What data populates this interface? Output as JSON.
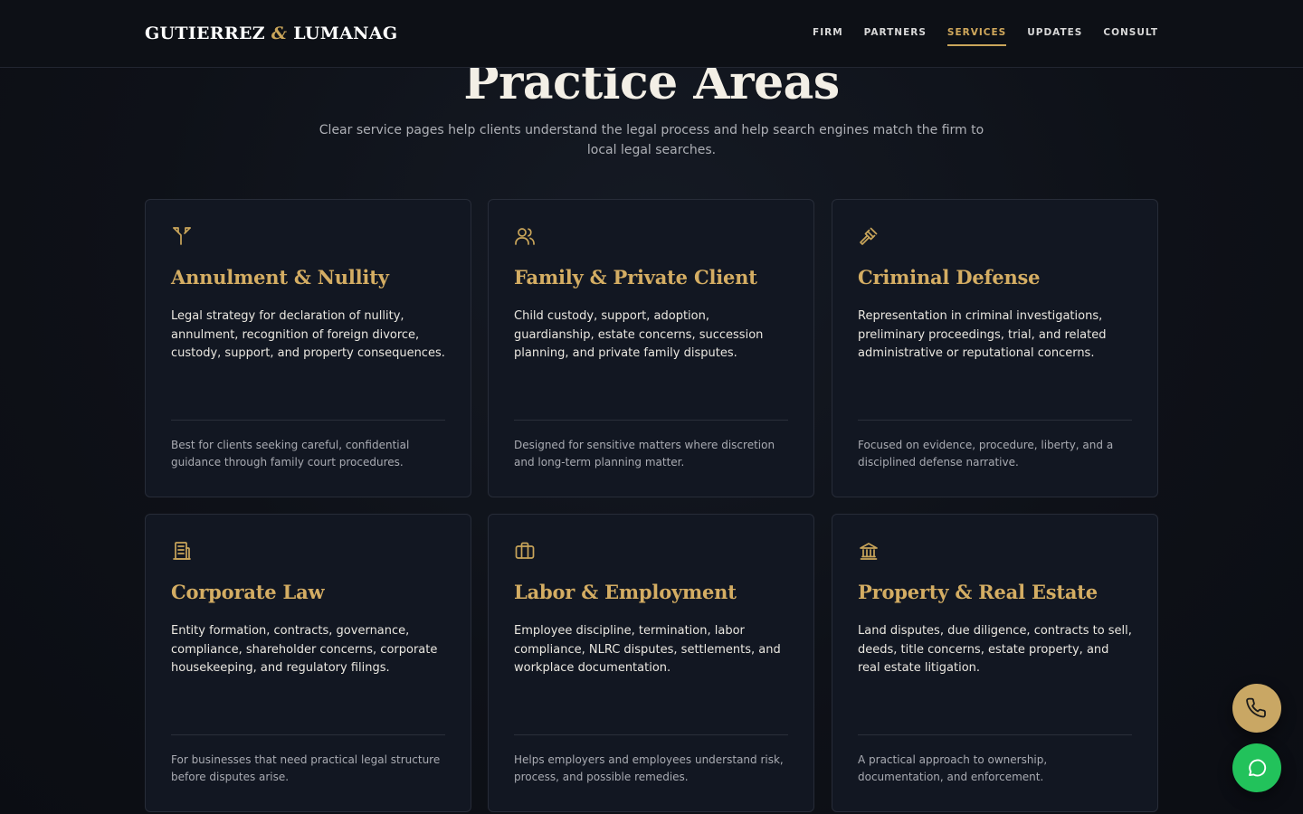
{
  "header": {
    "logo": {
      "left": "GUTIERREZ",
      "amp": "&",
      "right": "LUMANAG"
    },
    "nav": [
      {
        "label": "FIRM",
        "active": false
      },
      {
        "label": "PARTNERS",
        "active": false
      },
      {
        "label": "SERVICES",
        "active": true
      },
      {
        "label": "UPDATES",
        "active": false
      },
      {
        "label": "CONSULT",
        "active": false
      }
    ]
  },
  "section": {
    "title": "Practice Areas",
    "subtitle": "Clear service pages help clients understand the legal process and help search engines match the firm to local legal searches."
  },
  "cards": [
    {
      "icon": "split-arrows-icon",
      "title": "Annulment & Nullity",
      "description": "Legal strategy for declaration of nullity, annulment, recognition of foreign divorce, custody, support, and property consequences.",
      "note": "Best for clients seeking careful, confidential guidance through family court procedures."
    },
    {
      "icon": "users-icon",
      "title": "Family & Private Client",
      "description": "Child custody, support, adoption, guardianship, estate concerns, succession planning, and private family disputes.",
      "note": "Designed for sensitive matters where discretion and long-term planning matter."
    },
    {
      "icon": "gavel-icon",
      "title": "Criminal Defense",
      "description": "Representation in criminal investigations, preliminary proceedings, trial, and related administrative or reputational concerns.",
      "note": "Focused on evidence, procedure, liberty, and a disciplined defense narrative."
    },
    {
      "icon": "building-icon",
      "title": "Corporate Law",
      "description": "Entity formation, contracts, governance, compliance, shareholder concerns, corporate housekeeping, and regulatory filings.",
      "note": "For businesses that need practical legal structure before disputes arise."
    },
    {
      "icon": "briefcase-icon",
      "title": "Labor & Employment",
      "description": "Employee discipline, termination, labor compliance, NLRC disputes, settlements, and workplace documentation.",
      "note": "Helps employers and employees understand risk, process, and possible remedies."
    },
    {
      "icon": "landmark-icon",
      "title": "Property & Real Estate",
      "description": "Land disputes, due diligence, contracts to sell, deeds, title concerns, estate property, and real estate litigation.",
      "note": "A practical approach to ownership, documentation, and enforcement."
    }
  ],
  "floating_actions": [
    {
      "icon": "phone-icon",
      "color": "#c9a764"
    },
    {
      "icon": "chat-icon",
      "color": "#22c25b"
    }
  ],
  "colors": {
    "accent_gold": "#d4ad63",
    "background": "#0e1118",
    "card_background": "#121722",
    "whatsapp_green": "#22c25b"
  }
}
